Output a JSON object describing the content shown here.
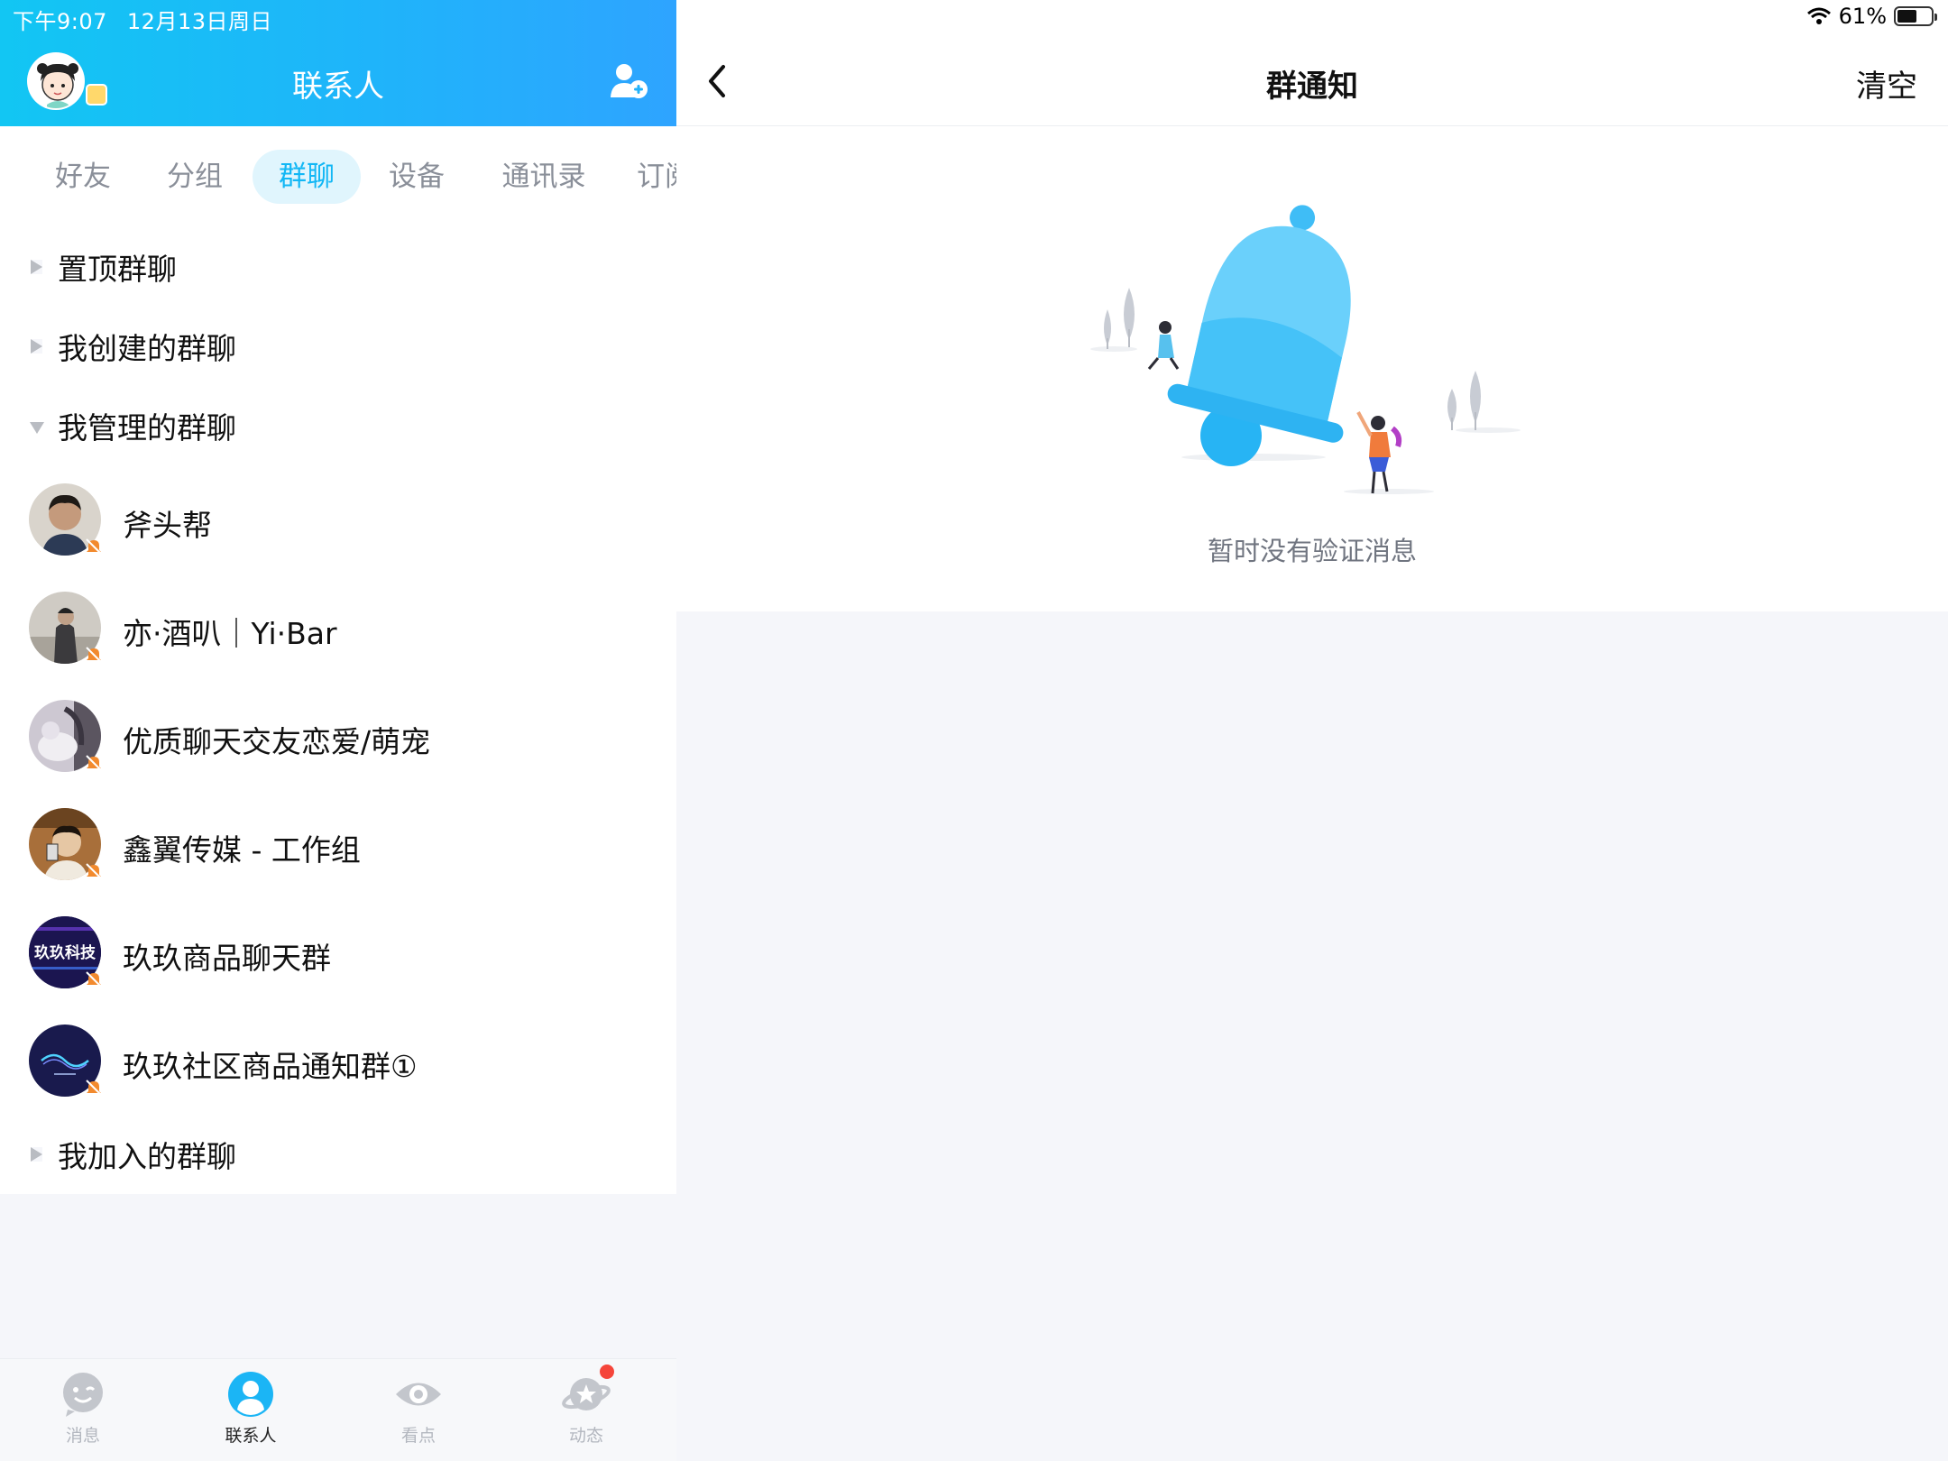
{
  "status_bar": {
    "time": "下午9:07",
    "date": "12月13日周日",
    "battery": "61%"
  },
  "left_header": {
    "title": "联系人"
  },
  "tabs": [
    {
      "label": "好友",
      "active": false
    },
    {
      "label": "分组",
      "active": false
    },
    {
      "label": "群聊",
      "active": true
    },
    {
      "label": "设备",
      "active": false
    },
    {
      "label": "通讯录",
      "active": false
    },
    {
      "label": "订阅",
      "active": false
    }
  ],
  "sections": {
    "pinned": {
      "label": "置顶群聊",
      "expanded": false
    },
    "created": {
      "label": "我创建的群聊",
      "expanded": false
    },
    "managed": {
      "label": "我管理的群聊",
      "expanded": true
    },
    "joined": {
      "label": "我加入的群聊",
      "expanded": false
    }
  },
  "groups": [
    {
      "name": "斧头帮",
      "avatar_color": "#5a4a3c"
    },
    {
      "name": "亦·酒叭｜Yi·Bar",
      "avatar_color": "#8f8c86"
    },
    {
      "name": "优质聊天交友恋爱/萌宠",
      "avatar_color": "#b9b2bd"
    },
    {
      "name": "鑫翼传媒 - 工作组",
      "avatar_color": "#8a5a2a"
    },
    {
      "name": "玖玖商品聊天群",
      "avatar_color": "#1b1550",
      "avatar_text": "玖玖科技"
    },
    {
      "name": "玖玖社区商品通知群①",
      "avatar_color": "#191a4d"
    }
  ],
  "bottom_nav": [
    {
      "label": "消息",
      "icon": "message-face-icon",
      "active": false
    },
    {
      "label": "联系人",
      "icon": "contacts-person-icon",
      "active": true
    },
    {
      "label": "看点",
      "icon": "eye-icon",
      "active": false
    },
    {
      "label": "动态",
      "icon": "planet-star-icon",
      "active": false,
      "badge_dot": true
    }
  ],
  "right_panel": {
    "back_icon": "chevron-left-icon",
    "title": "群通知",
    "clear_label": "清空",
    "empty_message": "暂时没有验证消息"
  },
  "colors": {
    "brand_blue": "#12b7f5",
    "header_gradient_start": "#12c6f3",
    "header_gradient_end": "#2ea4ff",
    "mute_badge": "#f28a2e",
    "red_dot": "#f5453a"
  }
}
